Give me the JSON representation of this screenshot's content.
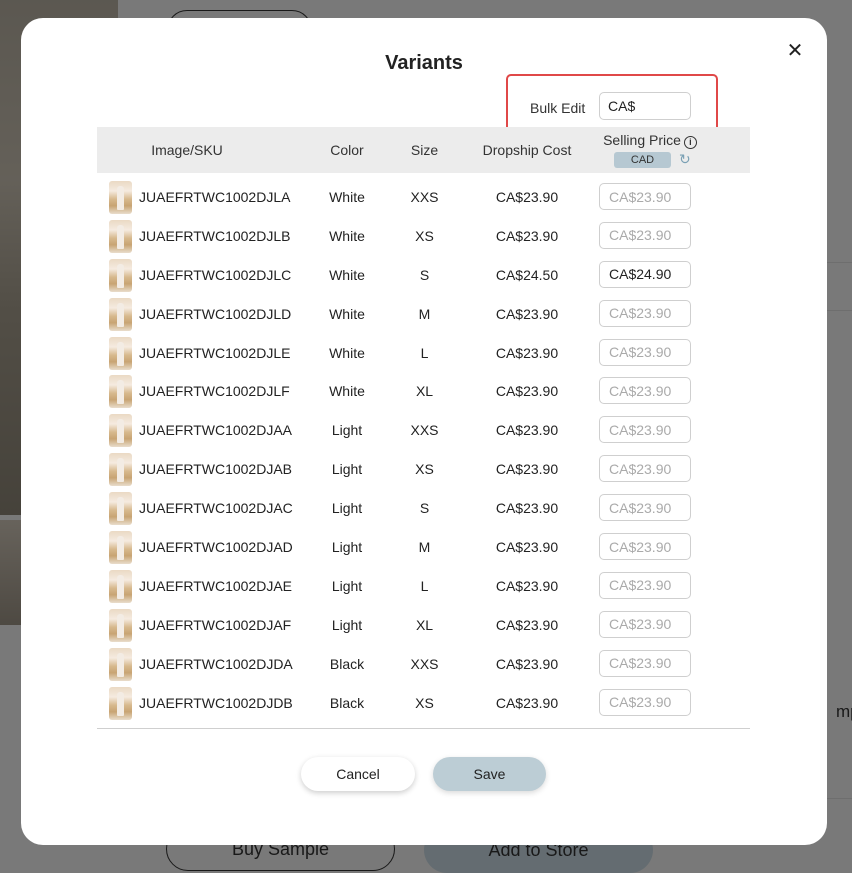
{
  "background": {
    "buy_sample_label": "Buy Sample",
    "add_to_store_label": "Add to Store",
    "right_text": "mple"
  },
  "modal": {
    "title": "Variants",
    "close_icon": "close-icon",
    "bulk_edit": {
      "label": "Bulk Edit",
      "placeholder": "CA$",
      "value": ""
    },
    "columns": {
      "image_sku": "Image/SKU",
      "color": "Color",
      "size": "Size",
      "dropship_cost": "Dropship Cost",
      "selling_price": "Selling Price",
      "currency_badge": "CAD"
    },
    "rows": [
      {
        "sku": "JUAEFRTWC1002DJLA",
        "color": "White",
        "size": "XXS",
        "cost": "CA$23.90",
        "price_placeholder": "CA$23.90",
        "price_value": ""
      },
      {
        "sku": "JUAEFRTWC1002DJLB",
        "color": "White",
        "size": "XS",
        "cost": "CA$23.90",
        "price_placeholder": "CA$23.90",
        "price_value": ""
      },
      {
        "sku": "JUAEFRTWC1002DJLC",
        "color": "White",
        "size": "S",
        "cost": "CA$24.50",
        "price_placeholder": "CA$24.90",
        "price_value": "CA$24.90"
      },
      {
        "sku": "JUAEFRTWC1002DJLD",
        "color": "White",
        "size": "M",
        "cost": "CA$23.90",
        "price_placeholder": "CA$23.90",
        "price_value": ""
      },
      {
        "sku": "JUAEFRTWC1002DJLE",
        "color": "White",
        "size": "L",
        "cost": "CA$23.90",
        "price_placeholder": "CA$23.90",
        "price_value": ""
      },
      {
        "sku": "JUAEFRTWC1002DJLF",
        "color": "White",
        "size": "XL",
        "cost": "CA$23.90",
        "price_placeholder": "CA$23.90",
        "price_value": ""
      },
      {
        "sku": "JUAEFRTWC1002DJAA",
        "color": "Light",
        "size": "XXS",
        "cost": "CA$23.90",
        "price_placeholder": "CA$23.90",
        "price_value": ""
      },
      {
        "sku": "JUAEFRTWC1002DJAB",
        "color": "Light",
        "size": "XS",
        "cost": "CA$23.90",
        "price_placeholder": "CA$23.90",
        "price_value": ""
      },
      {
        "sku": "JUAEFRTWC1002DJAC",
        "color": "Light",
        "size": "S",
        "cost": "CA$23.90",
        "price_placeholder": "CA$23.90",
        "price_value": ""
      },
      {
        "sku": "JUAEFRTWC1002DJAD",
        "color": "Light",
        "size": "M",
        "cost": "CA$23.90",
        "price_placeholder": "CA$23.90",
        "price_value": ""
      },
      {
        "sku": "JUAEFRTWC1002DJAE",
        "color": "Light",
        "size": "L",
        "cost": "CA$23.90",
        "price_placeholder": "CA$23.90",
        "price_value": ""
      },
      {
        "sku": "JUAEFRTWC1002DJAF",
        "color": "Light",
        "size": "XL",
        "cost": "CA$23.90",
        "price_placeholder": "CA$23.90",
        "price_value": ""
      },
      {
        "sku": "JUAEFRTWC1002DJDA",
        "color": "Black",
        "size": "XXS",
        "cost": "CA$23.90",
        "price_placeholder": "CA$23.90",
        "price_value": ""
      },
      {
        "sku": "JUAEFRTWC1002DJDB",
        "color": "Black",
        "size": "XS",
        "cost": "CA$23.90",
        "price_placeholder": "CA$23.90",
        "price_value": ""
      }
    ],
    "cancel_label": "Cancel",
    "save_label": "Save"
  },
  "colors": {
    "highlight_border": "#e04848",
    "save_button": "#bccdd5",
    "header_background": "#ececec",
    "badge": "#b6c8d2"
  }
}
